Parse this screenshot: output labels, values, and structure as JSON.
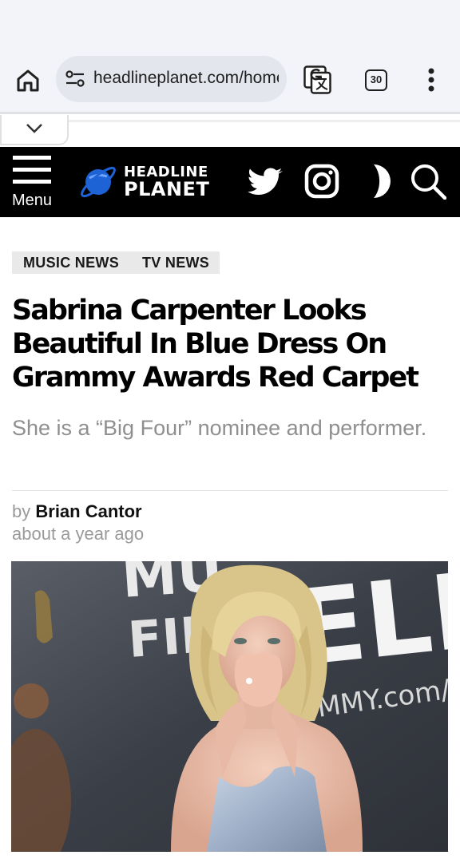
{
  "browser": {
    "url": "headlineplanet.com/home",
    "tab_count": "30"
  },
  "header": {
    "menu_label": "Menu",
    "logo_line1": "HEADLINE",
    "logo_line2": "PLANET"
  },
  "article": {
    "categories": [
      "MUSIC NEWS",
      "TV NEWS"
    ],
    "title": "Sabrina Carpenter Looks Beautiful In Blue Dress On Grammy Awards Red Carpet",
    "subtitle": "She is a “Big Four” nominee and performer.",
    "by_prefix": "by",
    "author": "Brian Cantor",
    "time": "about a year ago"
  },
  "photo": {
    "backdrop_text_1": "MU",
    "backdrop_text_2": "FIR",
    "backdrop_text_3": "ELI",
    "backdrop_text_4": "MMY.com/F"
  },
  "colors": {
    "header_bg": "#000000",
    "logo_accent": "#1e63d6",
    "chrome_bg": "#f3f4f9"
  }
}
